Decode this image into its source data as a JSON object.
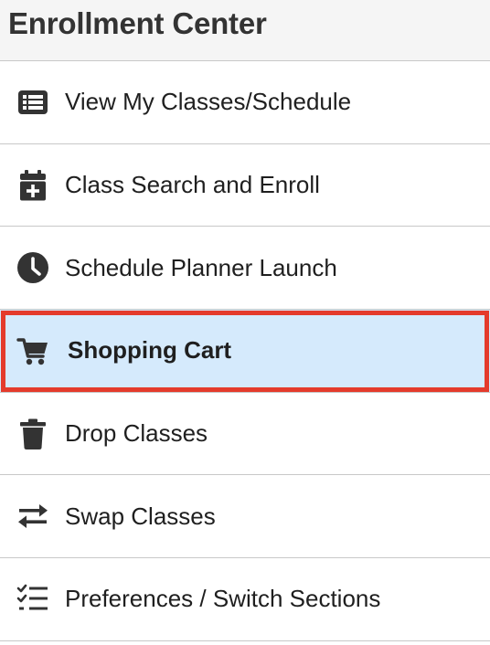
{
  "header": {
    "title": "Enrollment Center"
  },
  "menu": {
    "items": [
      {
        "label": "View My Classes/Schedule",
        "icon": "list-icon",
        "selected": false
      },
      {
        "label": "Class Search and Enroll",
        "icon": "calendar-plus-icon",
        "selected": false
      },
      {
        "label": "Schedule Planner Launch",
        "icon": "clock-icon",
        "selected": false
      },
      {
        "label": "Shopping Cart",
        "icon": "shopping-cart-icon",
        "selected": true
      },
      {
        "label": "Drop Classes",
        "icon": "trash-icon",
        "selected": false
      },
      {
        "label": "Swap Classes",
        "icon": "swap-arrows-icon",
        "selected": false
      },
      {
        "label": "Preferences / Switch Sections",
        "icon": "checklist-icon",
        "selected": false
      }
    ]
  },
  "colors": {
    "header_background": "#f5f5f5",
    "selected_background": "#d5eafc",
    "selected_border": "#e43b2c",
    "icon_color": "#333333",
    "divider": "#c8c8c8"
  }
}
